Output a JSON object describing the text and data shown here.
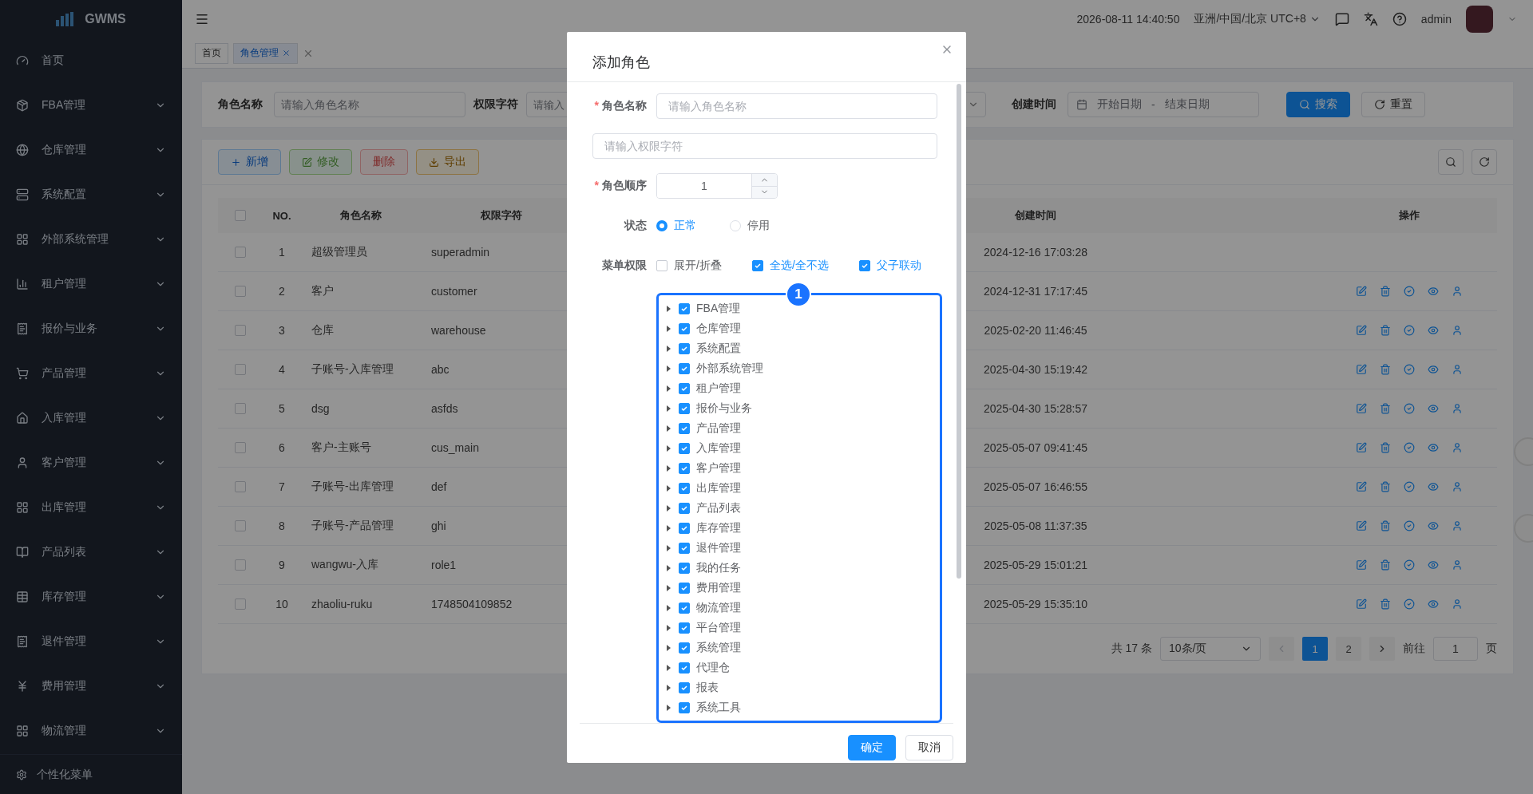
{
  "sidebar": {
    "logo": "GWMS",
    "items": [
      {
        "label": "首页",
        "expandable": false
      },
      {
        "label": "FBA管理",
        "expandable": true
      },
      {
        "label": "仓库管理",
        "expandable": true
      },
      {
        "label": "系统配置",
        "expandable": true
      },
      {
        "label": "外部系统管理",
        "expandable": true
      },
      {
        "label": "租户管理",
        "expandable": true
      },
      {
        "label": "报价与业务",
        "expandable": true
      },
      {
        "label": "产品管理",
        "expandable": true
      },
      {
        "label": "入库管理",
        "expandable": true
      },
      {
        "label": "客户管理",
        "expandable": true
      },
      {
        "label": "出库管理",
        "expandable": true
      },
      {
        "label": "产品列表",
        "expandable": true
      },
      {
        "label": "库存管理",
        "expandable": true
      },
      {
        "label": "退件管理",
        "expandable": true
      },
      {
        "label": "费用管理",
        "expandable": true
      },
      {
        "label": "物流管理",
        "expandable": true
      }
    ],
    "footer": "个性化菜单"
  },
  "header": {
    "datetime": "2026-08-11 14:40:50",
    "timezone": "亚洲/中国/北京 UTC+8",
    "user": "admin"
  },
  "tabs": [
    {
      "label": "首页",
      "selected": false,
      "closable": false
    },
    {
      "label": "角色管理",
      "selected": true,
      "closable": true
    }
  ],
  "search": {
    "fields": [
      {
        "label": "角色名称",
        "placeholder": "请输入角色名称"
      },
      {
        "label": "权限字符",
        "placeholder": "请输入"
      }
    ],
    "date_label": "创建时间",
    "date_start": "开始日期",
    "date_sep": "-",
    "date_end": "结束日期",
    "search_button": "搜索",
    "reset_button": "重置"
  },
  "toolbar": [
    {
      "label": "新增",
      "kind": "add",
      "disabled": false
    },
    {
      "label": "修改",
      "kind": "edit",
      "disabled": true
    },
    {
      "label": "删除",
      "kind": "delete",
      "disabled": true
    },
    {
      "label": "导出",
      "kind": "export",
      "disabled": false
    }
  ],
  "table": {
    "header_checked": false,
    "columns": [
      "NO.",
      "角色名称",
      "权限字符",
      "创建时间",
      "操作"
    ],
    "rows": [
      {
        "no": "1",
        "name": "超级管理员",
        "key": "superadmin",
        "created": "2024-12-16 17:03:28",
        "checked": false,
        "actions": false
      },
      {
        "no": "2",
        "name": "客户",
        "key": "customer",
        "created": "2024-12-31 17:17:45",
        "checked": false,
        "actions": true
      },
      {
        "no": "3",
        "name": "仓库",
        "key": "warehouse",
        "created": "2025-02-20 11:46:45",
        "checked": false,
        "actions": true
      },
      {
        "no": "4",
        "name": "子账号-入库管理",
        "key": "abc",
        "created": "2025-04-30 15:19:42",
        "checked": false,
        "actions": true
      },
      {
        "no": "5",
        "name": "dsg",
        "key": "asfds",
        "created": "2025-04-30 15:28:57",
        "checked": false,
        "actions": true
      },
      {
        "no": "6",
        "name": "客户-主账号",
        "key": "cus_main",
        "created": "2025-05-07 09:41:45",
        "checked": false,
        "actions": true
      },
      {
        "no": "7",
        "name": "子账号-出库管理",
        "key": "def",
        "created": "2025-05-07 16:46:55",
        "checked": false,
        "actions": true
      },
      {
        "no": "8",
        "name": "子账号-产品管理",
        "key": "ghi",
        "created": "2025-05-08 11:37:35",
        "checked": false,
        "actions": true
      },
      {
        "no": "9",
        "name": "wangwu-入库",
        "key": "role1",
        "created": "2025-05-29 15:01:21",
        "checked": false,
        "actions": true
      },
      {
        "no": "10",
        "name": "zhaoliu-ruku",
        "key": "1748504109852",
        "created": "2025-05-29 15:35:10",
        "checked": false,
        "actions": true
      }
    ]
  },
  "pagination": {
    "total": "共 17 条",
    "page_size": "10条/页",
    "pages": [
      {
        "label": "1",
        "selected": true
      },
      {
        "label": "2",
        "selected": false
      }
    ],
    "goto_label": "前往",
    "goto_value": "1",
    "goto_suffix": "页"
  },
  "dialog": {
    "title": "添加角色",
    "name_field": {
      "label": "角色名称",
      "required_mark": "*",
      "required": true,
      "placeholder": "请输入角色名称"
    },
    "key_field": {
      "placeholder": "请输入权限字符"
    },
    "order_field": {
      "label": "角色顺序",
      "required_mark": "*",
      "required": true,
      "value": "1"
    },
    "status": {
      "label": "状态",
      "options": [
        {
          "label": "正常",
          "selected": true
        },
        {
          "label": "停用",
          "selected": false
        }
      ]
    },
    "menu": {
      "label": "菜单权限",
      "options": [
        {
          "label": "展开/折叠",
          "checked": false
        },
        {
          "label": "全选/全不选",
          "checked": true
        },
        {
          "label": "父子联动",
          "checked": true
        }
      ],
      "tree": [
        {
          "label": "FBA管理",
          "checked": true
        },
        {
          "label": "仓库管理",
          "checked": true
        },
        {
          "label": "系统配置",
          "checked": true
        },
        {
          "label": "外部系统管理",
          "checked": true
        },
        {
          "label": "租户管理",
          "checked": true
        },
        {
          "label": "报价与业务",
          "checked": true
        },
        {
          "label": "产品管理",
          "checked": true
        },
        {
          "label": "入库管理",
          "checked": true
        },
        {
          "label": "客户管理",
          "checked": true
        },
        {
          "label": "出库管理",
          "checked": true
        },
        {
          "label": "产品列表",
          "checked": true
        },
        {
          "label": "库存管理",
          "checked": true
        },
        {
          "label": "退件管理",
          "checked": true
        },
        {
          "label": "我的任务",
          "checked": true
        },
        {
          "label": "费用管理",
          "checked": true
        },
        {
          "label": "物流管理",
          "checked": true
        },
        {
          "label": "平台管理",
          "checked": true
        },
        {
          "label": "系统管理",
          "checked": true
        },
        {
          "label": "代理仓",
          "checked": true
        },
        {
          "label": "报表",
          "checked": true
        },
        {
          "label": "系统工具",
          "checked": true
        }
      ]
    },
    "annotation": "1",
    "confirm_button": "确定",
    "cancel_button": "取消"
  }
}
